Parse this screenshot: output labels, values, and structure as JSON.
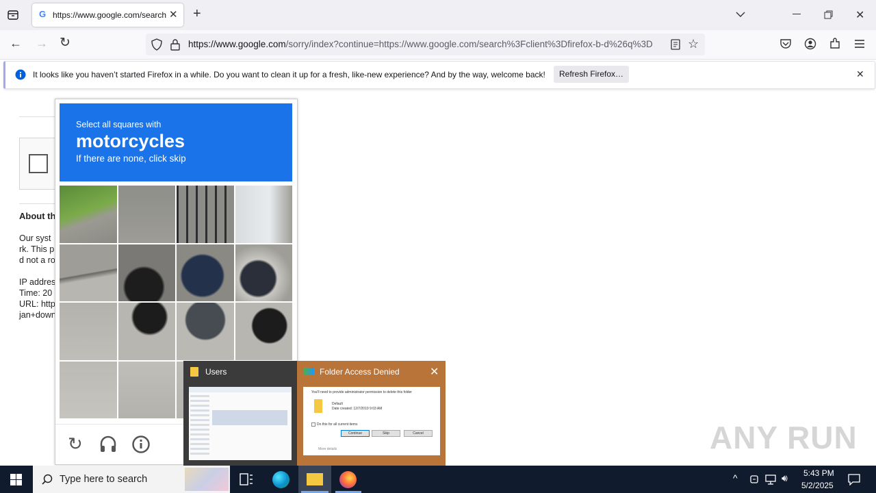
{
  "browser": {
    "tab_title": "https://www.google.com/search",
    "url_host": "https://www.google.com",
    "url_path": "/sorry/index?continue=https://www.google.com/search%3Fclient%3Dfirefox-b-d%26q%3D",
    "notification": "It looks like you haven’t started Firefox in a while. Do you want to clean it up for a fresh, like-new experience? And by the way, welcome back!",
    "refresh_button": "Refresh Firefox…"
  },
  "page": {
    "about_heading": "About th",
    "line1": "Our syst",
    "line2": "rk. This p",
    "line3": "d not a ro",
    "ip": "IP addres",
    "time": "Time: 20",
    "url": "URL: http",
    "url2": "jan+down"
  },
  "captcha": {
    "instruction": "Select all squares with",
    "target": "motorcycles",
    "hint": "If there are none, click skip"
  },
  "thumbnails": {
    "users_title": "Users",
    "folder_title": "Folder Access Denied",
    "folder_msg": "You'll need to provide administrator permission to delete this folder",
    "folder_name": "Default",
    "folder_date": "Date created: 12/7/2019 9:03 AM",
    "checkbox_label": "Do this for all current items",
    "continue": "Continue",
    "skip": "Skip",
    "cancel": "Cancel",
    "more": "More details"
  },
  "taskbar": {
    "search_placeholder": "Type here to search",
    "time": "5:43 PM",
    "date": "5/2/2025"
  },
  "watermark": "ANY RUN",
  "colors": {
    "accent": "#1a73e8",
    "taskbar": "#101b2e"
  }
}
